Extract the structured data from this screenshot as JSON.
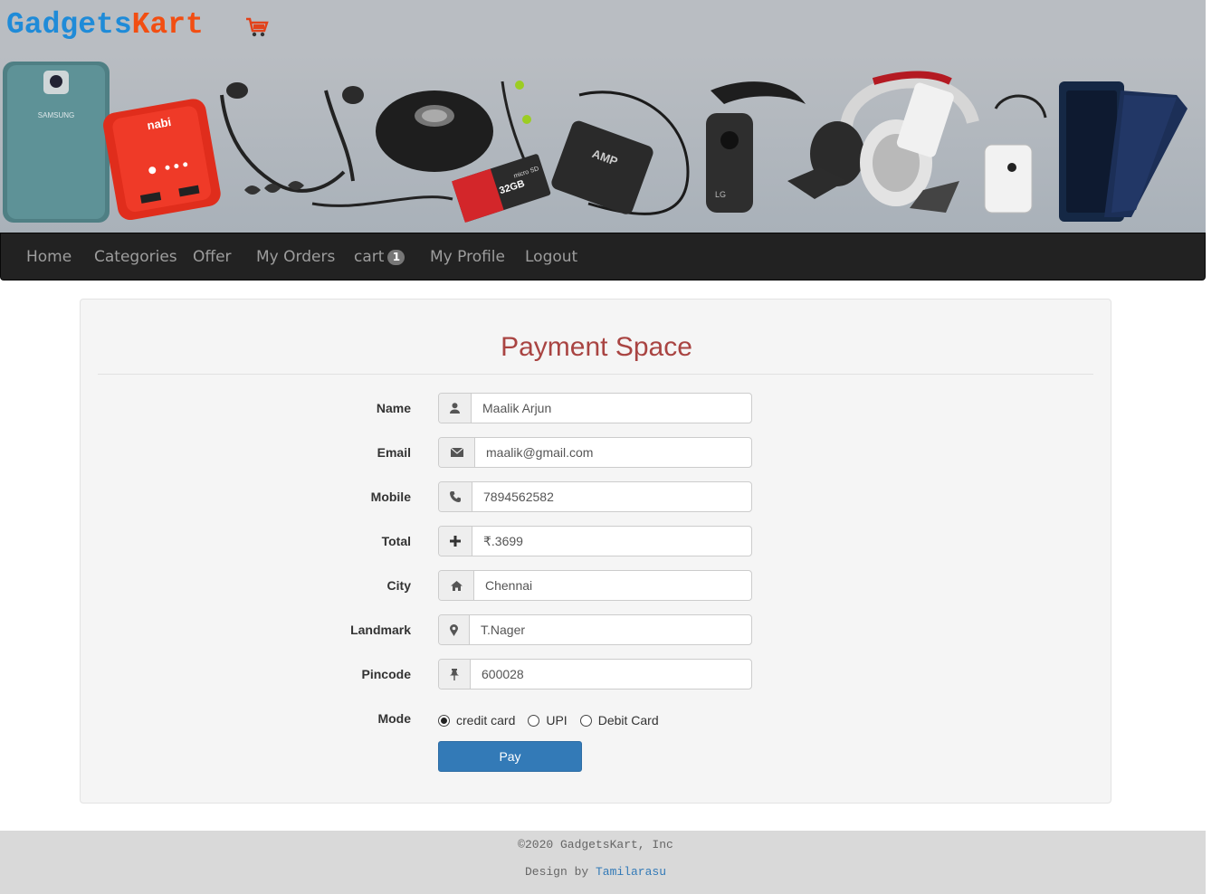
{
  "brand": {
    "part1": "Gadgets",
    "part2": "Kart",
    "cart_icon": "shopping-cart-icon"
  },
  "colors": {
    "brand_blue": "#1f8bd8",
    "brand_orange": "#f24e12",
    "navbar": "#222222",
    "title": "#a94442",
    "primary": "#337ab7"
  },
  "nav": {
    "home": "Home",
    "categories": "Categories",
    "offer": "Offer",
    "orders": "My Orders",
    "cart": "cart",
    "cart_count": "1",
    "profile": "My Profile",
    "logout": "Logout"
  },
  "form": {
    "title": "Payment Space",
    "fields": [
      {
        "label": "Name",
        "icon": "user-icon",
        "value": "Maalik Arjun"
      },
      {
        "label": "Email",
        "icon": "envelope-icon",
        "value": "maalik@gmail.com"
      },
      {
        "label": "Mobile",
        "icon": "phone-icon",
        "value": "7894562582"
      },
      {
        "label": "Total",
        "icon": "plus-icon",
        "value": "₹.3699"
      },
      {
        "label": "City",
        "icon": "home-icon",
        "value": "Chennai"
      },
      {
        "label": "Landmark",
        "icon": "map-marker-icon",
        "value": "T.Nager"
      },
      {
        "label": "Pincode",
        "icon": "pushpin-icon",
        "value": "600028"
      }
    ],
    "mode_label": "Mode",
    "modes": [
      {
        "label": "credit card",
        "selected": true
      },
      {
        "label": "UPI",
        "selected": false
      },
      {
        "label": "Debit Card",
        "selected": false
      }
    ],
    "pay_button": "Pay"
  },
  "banner": {
    "samsung_text": "SAMSUNG",
    "nabi_text": "nabi",
    "sd_text": "32GB",
    "sd_text2": "micro SD",
    "amp_text": "AMP",
    "lg_text": "LG"
  },
  "footer": {
    "copyright": "©2020 GadgetsKart, Inc",
    "design_by": "Design by",
    "designer": "Tamilarasu"
  }
}
